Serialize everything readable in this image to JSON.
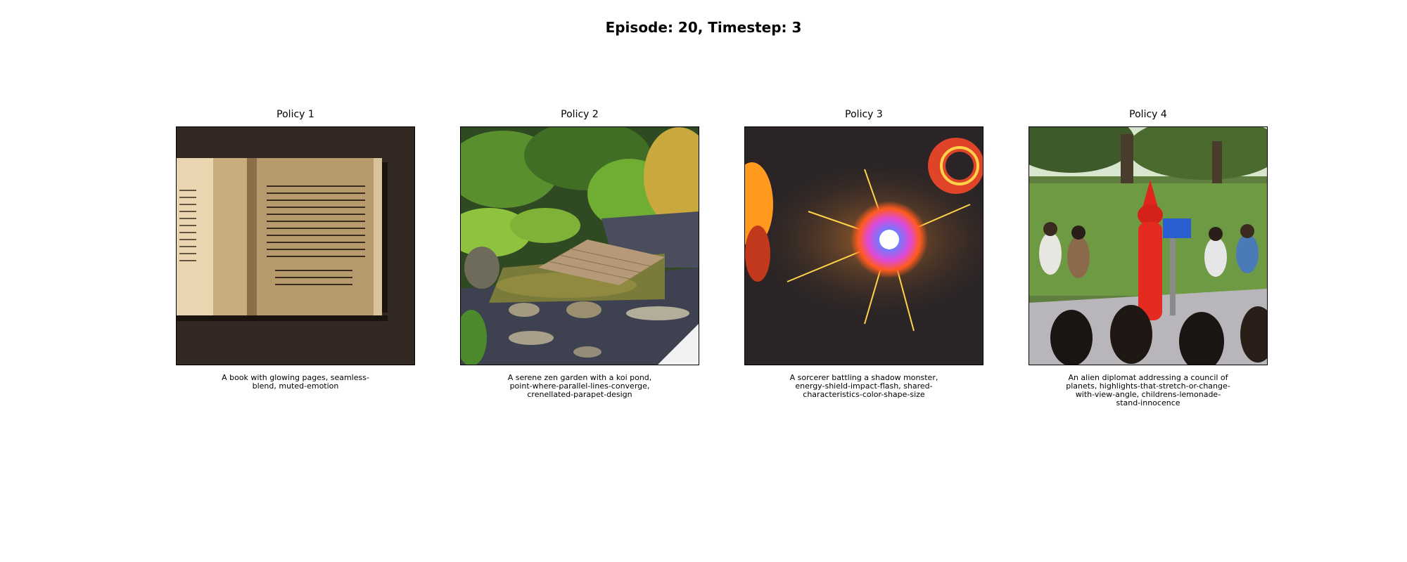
{
  "figure": {
    "title": "Episode: 20, Timestep: 3"
  },
  "panels": [
    {
      "title": "Policy 1",
      "caption": "A book with glowing pages, seamless-blend, muted-emotion"
    },
    {
      "title": "Policy 2",
      "caption": "A serene zen garden with a koi pond, point-where-parallel-lines-converge, crenellated-parapet-design"
    },
    {
      "title": "Policy 3",
      "caption": "A sorcerer battling a shadow monster, energy-shield-impact-flash, shared-characteristics-color-shape-size"
    },
    {
      "title": "Policy 4",
      "caption": "An alien diplomat addressing a council of planets, highlights-that-stretch-or-change-with-view-angle, childrens-lemonade-stand-innocence"
    }
  ]
}
